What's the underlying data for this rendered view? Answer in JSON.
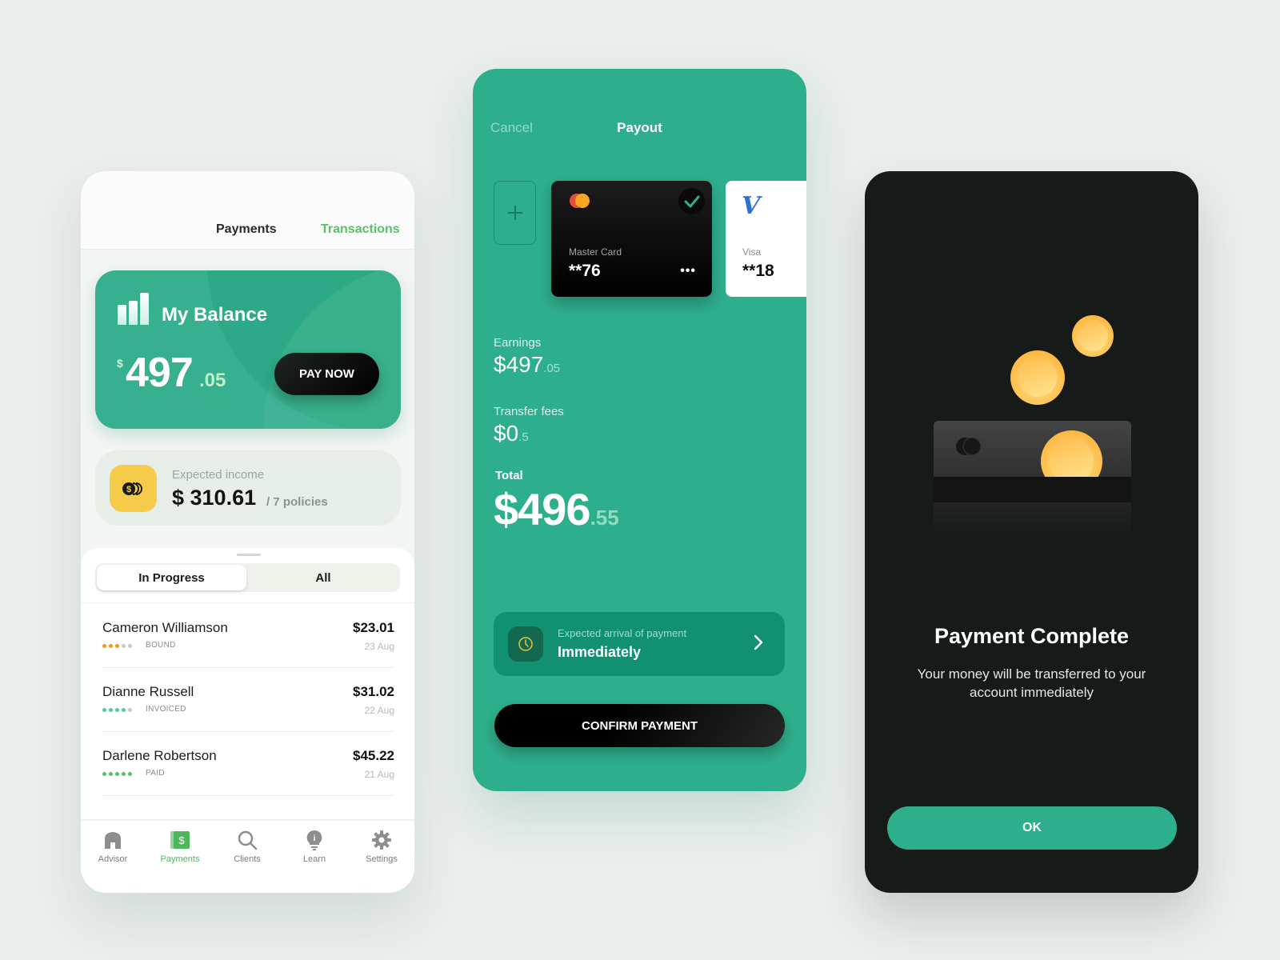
{
  "screen_balance": {
    "tabs": [
      {
        "label": "Payments",
        "active": false
      },
      {
        "label": "Transactions",
        "active": true
      }
    ],
    "balance": {
      "title": "My Balance",
      "currency": "$",
      "amount_int": "497",
      "amount_dec": ".05",
      "pay_button": "PAY NOW"
    },
    "income": {
      "label": "Expected income",
      "amount": "$ 310.61",
      "sub": "/ 7 policies",
      "icon": "coins-icon",
      "icon_color": "#f7cb4a"
    },
    "filter": {
      "options": [
        "In Progress",
        "All"
      ],
      "selected": "In Progress"
    },
    "transactions": [
      {
        "name": "Cameron Williamson",
        "amount": "$23.01",
        "date": "23 Aug",
        "status": "BOUND",
        "progress": 3,
        "steps": 5,
        "color": "#f7931e"
      },
      {
        "name": "Dianne Russell",
        "amount": "$31.02",
        "date": "22 Aug",
        "status": "INVOICED",
        "progress": 4,
        "steps": 5,
        "color": "#4ecba5"
      },
      {
        "name": "Darlene Robertson",
        "amount": "$45.22",
        "date": "21 Aug",
        "status": "PAID",
        "progress": 5,
        "steps": 5,
        "color": "#5cbf6a"
      }
    ],
    "nav": [
      {
        "label": "Advisor",
        "icon": "home-icon",
        "active": false
      },
      {
        "label": "Payments",
        "icon": "payments-icon",
        "active": true
      },
      {
        "label": "Clients",
        "icon": "search-icon",
        "active": false
      },
      {
        "label": "Learn",
        "icon": "lightbulb-icon",
        "active": false
      },
      {
        "label": "Settings",
        "icon": "gear-icon",
        "active": false
      }
    ]
  },
  "screen_payout": {
    "cancel": "Cancel",
    "title": "Payout",
    "cards": [
      {
        "type": "Master Card",
        "number": "**76",
        "selected": true,
        "more": "•••"
      },
      {
        "type": "Visa",
        "number": "**18",
        "selected": false,
        "logo": "V"
      }
    ],
    "earnings": {
      "label": "Earnings",
      "int": "$497",
      "dec": ".05"
    },
    "fees": {
      "label": "Transfer fees",
      "int": "$0",
      "dec": ".5"
    },
    "total": {
      "label": "Total",
      "int": "$496",
      "dec": ".55"
    },
    "arrival": {
      "label": "Expected arrival of payment",
      "value": "Immediately"
    },
    "confirm": "CONFIRM PAYMENT",
    "accent": "#2eaf8c"
  },
  "screen_complete": {
    "title": "Payment Complete",
    "message": "Your money will be transferred to your account immediately",
    "ok": "OK"
  }
}
